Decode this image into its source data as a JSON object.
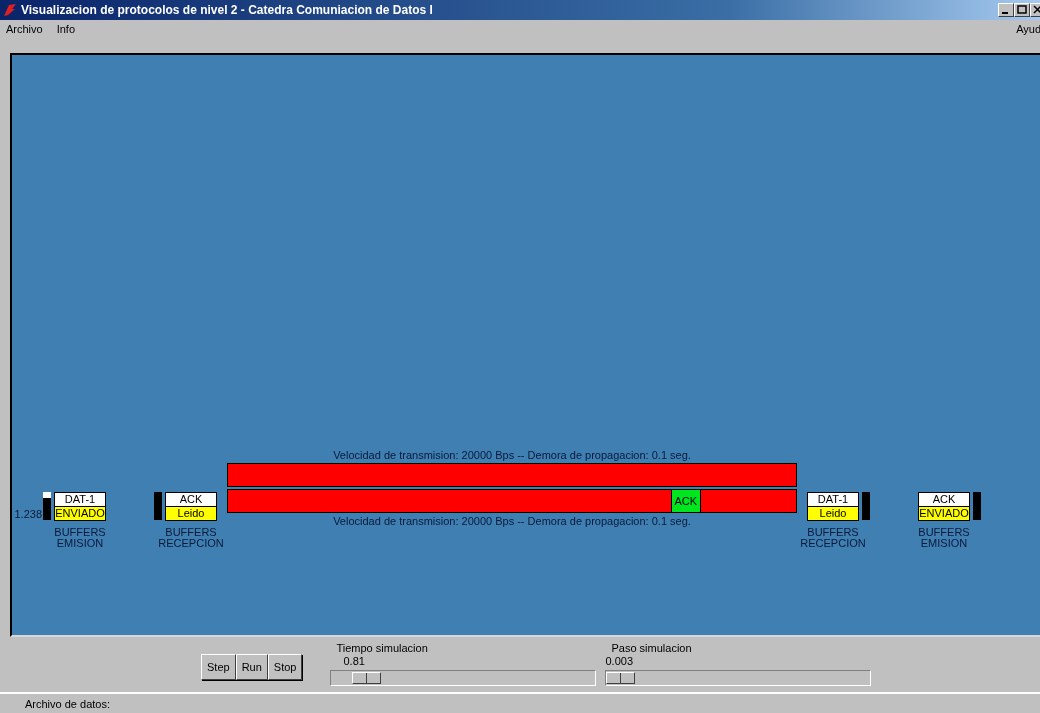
{
  "window": {
    "title": "Visualizacion de protocolos de nivel 2 - Catedra Comuniacion de Datos I"
  },
  "menu": {
    "left": [
      "Archivo",
      "Info"
    ],
    "right": "Ayud"
  },
  "buffers": [
    {
      "kind": "left",
      "reading": "1.238",
      "level": 0.8,
      "packet": "DAT-1",
      "status": "ENVIADO",
      "label": [
        "BUFFERS",
        "EMISION"
      ]
    },
    {
      "kind": "left",
      "level": 1,
      "packet": "ACK",
      "status": "Leido",
      "label": [
        "BUFFERS",
        "RECEPCION"
      ]
    },
    {
      "kind": "right",
      "level": 1,
      "packet": "DAT-1",
      "status": "Leido",
      "label": [
        "BUFFERS",
        "RECEPCION"
      ]
    },
    {
      "kind": "right",
      "level": 1,
      "packet": "ACK",
      "status": "ENVIADO",
      "label": [
        "BUFFERS",
        "EMISION"
      ]
    }
  ],
  "channel": {
    "top_caption": "Velocidad de transmision: 20000 Bps  -- Demora de propagacion: 0.1 seg.",
    "bottom_caption": "Velocidad de transmision: 20000 Bps  -- Demora de propagacion: 0.1 seg.",
    "packets": [
      {
        "kind": "lower",
        "label": "ACK",
        "level": 0.82
      }
    ]
  },
  "controls": {
    "buttons": [
      "Step",
      "Run",
      "Stop"
    ],
    "sliders": [
      {
        "label": "Tiempo simulacion",
        "reading": "0.81",
        "level": 0.09
      },
      {
        "label": "Paso simulacion",
        "reading": "0.003",
        "level": 0
      }
    ]
  },
  "status_bar": {
    "text": "Archivo de datos:"
  }
}
